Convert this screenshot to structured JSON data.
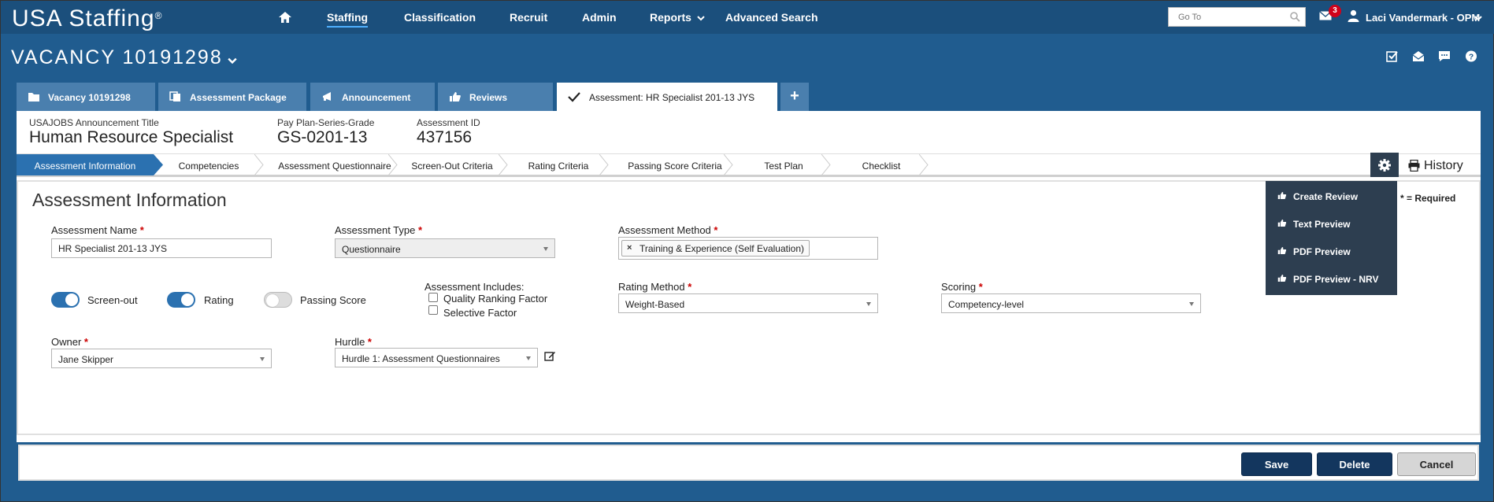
{
  "app": {
    "logo": "USA Staffing",
    "logo_reg": "®"
  },
  "nav": {
    "items": [
      {
        "label": "Staffing"
      },
      {
        "label": "Classification"
      },
      {
        "label": "Recruit"
      },
      {
        "label": "Admin"
      },
      {
        "label": "Reports"
      },
      {
        "label": "Advanced Search"
      }
    ],
    "goto_placeholder": "Go To",
    "mail_badge": "3",
    "user": "Laci Vandermark - OPM"
  },
  "vacancy": {
    "title": "VACANCY 10191298"
  },
  "tabs": [
    {
      "label": "Vacancy 10191298",
      "icon": "folder-icon"
    },
    {
      "label": "Assessment Package",
      "icon": "copy-icon"
    },
    {
      "label": "Announcement",
      "icon": "megaphone-icon"
    },
    {
      "label": "Reviews",
      "icon": "thumbs-up-icon"
    },
    {
      "label": "Assessment: HR Specialist 201-13 JYS",
      "icon": "check-icon"
    }
  ],
  "tab_add": "+",
  "meta": {
    "title_label": "USAJOBS Announcement Title",
    "title_value": "Human Resource Specialist",
    "grade_label": "Pay Plan-Series-Grade",
    "grade_value": "GS-0201-13",
    "id_label": "Assessment ID",
    "id_value": "437156"
  },
  "steps": [
    {
      "label": "Assessment Information"
    },
    {
      "label": "Competencies"
    },
    {
      "label": "Assessment Questionnaire"
    },
    {
      "label": "Screen-Out Criteria"
    },
    {
      "label": "Rating Criteria"
    },
    {
      "label": "Passing Score Criteria"
    },
    {
      "label": "Test Plan"
    },
    {
      "label": "Checklist"
    }
  ],
  "history_label": "History",
  "form": {
    "section_title": "Assessment Information",
    "required_note": "* = Required",
    "assessment_name_label": "Assessment Name",
    "assessment_name_value": "HR Specialist 201-13 JYS",
    "assessment_type_label": "Assessment Type",
    "assessment_type_value": "Questionnaire",
    "assessment_method_label": "Assessment Method",
    "assessment_method_tag": "Training & Experience (Self Evaluation)",
    "tag_remove": "×",
    "toggles": [
      {
        "label": "Screen-out",
        "on": true
      },
      {
        "label": "Rating",
        "on": true
      },
      {
        "label": "Passing Score",
        "on": false
      }
    ],
    "includes_label": "Assessment Includes:",
    "includes": [
      {
        "label": "Quality Ranking Factor",
        "checked": false
      },
      {
        "label": "Selective Factor",
        "checked": false
      }
    ],
    "rating_method_label": "Rating Method",
    "rating_method_value": "Weight-Based",
    "scoring_label": "Scoring",
    "scoring_value": "Competency-level",
    "owner_label": "Owner",
    "owner_value": "Jane Skipper",
    "hurdle_label": "Hurdle",
    "hurdle_value": "Hurdle 1: Assessment Questionnaires",
    "star": "*"
  },
  "menu": {
    "items": [
      {
        "label": "Create Review"
      },
      {
        "label": "Text Preview"
      },
      {
        "label": "PDF Preview"
      },
      {
        "label": "PDF Preview - NRV"
      }
    ]
  },
  "footer": {
    "save": "Save",
    "delete": "Delete",
    "cancel": "Cancel"
  },
  "colors": {
    "nav_bg": "#1b4f7c",
    "page_bg": "#205c8f",
    "tab_bg": "#4a7fae",
    "accent": "#2b71b0",
    "menu_bg": "#2d3e50",
    "primary_button": "#13365e",
    "required": "#cc0000"
  }
}
